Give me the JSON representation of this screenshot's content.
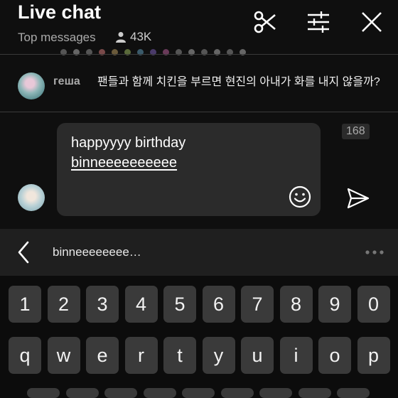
{
  "header": {
    "title": "Live chat",
    "subtitle": "Top messages",
    "viewer_count": "43K"
  },
  "message": {
    "author": "геша",
    "text": "팬들과 함께 치킨을 부르면 현진의 아내가 화를 내지 않을까?"
  },
  "composer": {
    "line1": "happyyyy birthday",
    "line2": "binneeeeeeeeee",
    "char_count": "168"
  },
  "suggestion": {
    "word": "binneeeeeeee…"
  },
  "keyboard": {
    "row_numbers": [
      "1",
      "2",
      "3",
      "4",
      "5",
      "6",
      "7",
      "8",
      "9",
      "0"
    ],
    "row_letters": [
      "q",
      "w",
      "e",
      "r",
      "t",
      "y",
      "u",
      "i",
      "o",
      "p"
    ]
  },
  "colors": {
    "background": "#0f0f0f",
    "key": "#3a3a3a",
    "input_box": "#2b2b2b"
  }
}
